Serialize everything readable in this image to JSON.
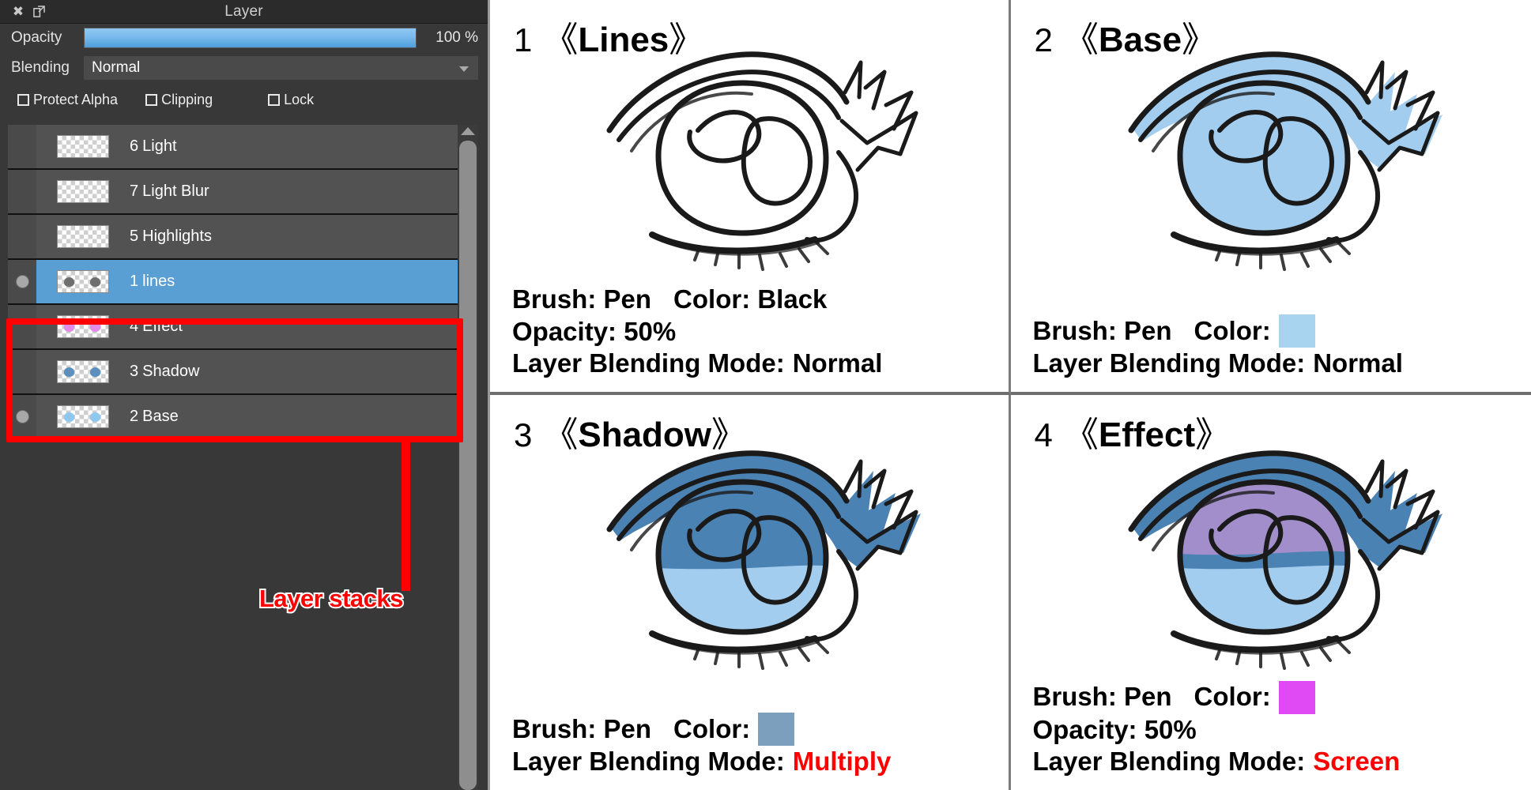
{
  "panel": {
    "title": "Layer",
    "close_icon": "close-icon",
    "popout_icon": "popout-icon",
    "opacity": {
      "label": "Opacity",
      "value": "100 %",
      "fill_percent": 100
    },
    "blending": {
      "label": "Blending",
      "value": "Normal"
    },
    "checkboxes": [
      {
        "label": "Protect Alpha",
        "checked": false
      },
      {
        "label": "Clipping",
        "checked": false
      },
      {
        "label": "Lock",
        "checked": false
      }
    ],
    "layers": [
      {
        "num": "6",
        "name": "Light",
        "selected": false,
        "visible_dot": false,
        "thumb_color": "transparent"
      },
      {
        "num": "7",
        "name": "Light Blur",
        "selected": false,
        "visible_dot": false,
        "thumb_color": "transparent"
      },
      {
        "num": "5",
        "name": "Highlights",
        "selected": false,
        "visible_dot": false,
        "thumb_color": "transparent"
      },
      {
        "num": "1",
        "name": "lines",
        "selected": true,
        "visible_dot": true,
        "thumb_color": "#6e6e6e"
      },
      {
        "num": "4",
        "name": "Effect",
        "selected": false,
        "visible_dot": false,
        "thumb_color": "#e08ce8"
      },
      {
        "num": "3",
        "name": "Shadow",
        "selected": false,
        "visible_dot": false,
        "thumb_color": "#5c8fbe"
      },
      {
        "num": "2",
        "name": "Base",
        "selected": false,
        "visible_dot": true,
        "thumb_color": "#8ec8ef"
      }
    ],
    "annotation": {
      "label": "Layer stacks",
      "color": "#ff0000"
    }
  },
  "steps": [
    {
      "num": "1",
      "bracket_open": "《",
      "name": "Lines",
      "bracket_close": "》",
      "brush_label": "Brush: Pen",
      "color_label": "Color: Black",
      "color_swatch": null,
      "opacity_label": "Opacity: 50%",
      "mode_label": "Layer Blending Mode:",
      "mode_value": "Normal",
      "mode_is_red": false
    },
    {
      "num": "2",
      "bracket_open": "《",
      "name": "Base",
      "bracket_close": "》",
      "brush_label": "Brush: Pen",
      "color_label": "Color:",
      "color_swatch": "#a8d4f0",
      "opacity_label": null,
      "mode_label": "Layer Blending Mode:",
      "mode_value": "Normal",
      "mode_is_red": false
    },
    {
      "num": "3",
      "bracket_open": "《",
      "name": "Shadow",
      "bracket_close": "》",
      "brush_label": "Brush: Pen",
      "color_label": "Color:",
      "color_swatch": "#7c9fbe",
      "opacity_label": null,
      "mode_label": "Layer Blending Mode:",
      "mode_value": "Multiply",
      "mode_is_red": true
    },
    {
      "num": "4",
      "bracket_open": "《",
      "name": "Effect",
      "bracket_close": "》",
      "brush_label": "Brush: Pen",
      "color_label": "Color:",
      "color_swatch": "#e04af5",
      "opacity_label": "Opacity: 50%",
      "mode_label": "Layer Blending Mode:",
      "mode_value": "Screen",
      "mode_is_red": true
    }
  ],
  "artwork": {
    "subject": "anime-eye",
    "base_fill": "#a3cdee",
    "shadow_fill": "#4b82b4",
    "effect_fill": "#a98fcc",
    "line_color": "#1a1a1a"
  }
}
